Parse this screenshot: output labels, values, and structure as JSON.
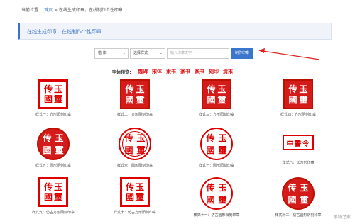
{
  "breadcrumb": {
    "prefix": "当前位置：",
    "home": "首页",
    "sep": " > ",
    "current": "在线生成印章，在线制作个性印章"
  },
  "banner": {
    "text": "在线生成印章，在线制作个性印章"
  },
  "toolbar": {
    "font_select": "楷 体",
    "style_select": "选择样式",
    "input_placeholder": "输入印章文字",
    "button": "制作印章"
  },
  "font_preview": {
    "label": "字体预览：",
    "fonts": [
      "魏碑",
      "宋体",
      "隶书",
      "篆书",
      "篆书",
      "刻印",
      "清末"
    ]
  },
  "stamp_text": {
    "c1": "玉",
    "c2": "传",
    "c3": "璽",
    "c4": "國",
    "line": "中書令"
  },
  "stamps": [
    {
      "caption": "样式一：方形阳刻印章"
    },
    {
      "caption": "样式二：方形阴刻印章"
    },
    {
      "caption": "样式三：方形阳刻印章"
    },
    {
      "caption": "样式四：方形阴刻印章"
    },
    {
      "caption": "样式五：圆形阴刻印章"
    },
    {
      "caption": "样式六：圆形阳刻印章"
    },
    {
      "caption": "样式七：圆形阳刻印章"
    },
    {
      "caption": "样式八：长方形印章"
    },
    {
      "caption": "样式九：仿古方形阴刻印章"
    },
    {
      "caption": "样式十：仿古方形阳刻印章"
    },
    {
      "caption": "样式十一：仿古圆形阳刻印章"
    },
    {
      "caption": "样式十二：仿古圆形阴刻印章"
    }
  ],
  "watermark": "系统之家",
  "colors": {
    "accent": "#3a76cc",
    "stamp_red": "#d51a1a"
  }
}
